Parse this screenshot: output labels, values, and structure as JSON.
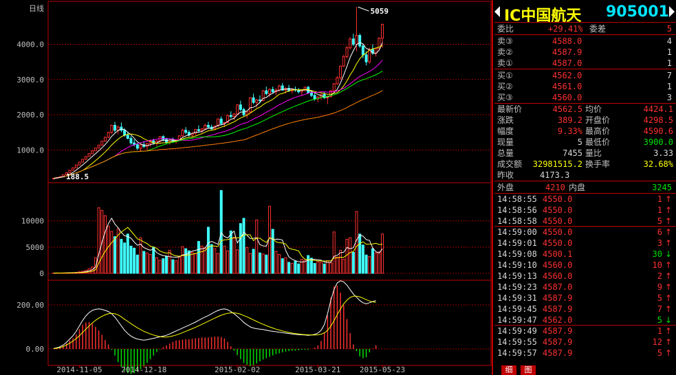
{
  "chart_data": {
    "type": "candlestick",
    "period_label": "日线",
    "price_ticks": [
      "4000.0",
      "3000.0",
      "2000.0",
      "1000.0"
    ],
    "vol_ticks": [
      "10000",
      "5000",
      "0"
    ],
    "macd_ticks": [
      "200.00",
      "0.00"
    ],
    "date_labels": [
      "2014-11-05",
      "2014-12-18",
      "2015-02-02",
      "2015-03-21",
      "2015-05-23"
    ],
    "max_label": "5059",
    "min_label": "188.5",
    "ohlc": [
      [
        190,
        200,
        188.5,
        198
      ],
      [
        200,
        220,
        198,
        218
      ],
      [
        218,
        250,
        215,
        245
      ],
      [
        245,
        300,
        240,
        295
      ],
      [
        295,
        360,
        290,
        355
      ],
      [
        355,
        430,
        350,
        425
      ],
      [
        425,
        500,
        420,
        495
      ],
      [
        495,
        580,
        490,
        575
      ],
      [
        575,
        660,
        570,
        655
      ],
      [
        655,
        740,
        650,
        735
      ],
      [
        735,
        820,
        730,
        815
      ],
      [
        815,
        900,
        810,
        895
      ],
      [
        895,
        980,
        890,
        975
      ],
      [
        975,
        1060,
        970,
        1055
      ],
      [
        1055,
        1150,
        1050,
        1140
      ],
      [
        1140,
        1260,
        1120,
        1250
      ],
      [
        1250,
        1380,
        1230,
        1360
      ],
      [
        1360,
        1520,
        1340,
        1500
      ],
      [
        1500,
        1720,
        1450,
        1700
      ],
      [
        1700,
        1800,
        1500,
        1560
      ],
      [
        1560,
        1700,
        1450,
        1650
      ],
      [
        1650,
        1780,
        1500,
        1560
      ],
      [
        1560,
        1620,
        1380,
        1420
      ],
      [
        1420,
        1500,
        1300,
        1330
      ],
      [
        1330,
        1400,
        1150,
        1200
      ],
      [
        1200,
        1300,
        1100,
        1150
      ],
      [
        1150,
        1200,
        1000,
        1050
      ],
      [
        1050,
        1180,
        950,
        1150
      ],
      [
        1150,
        1250,
        1050,
        1100
      ],
      [
        1100,
        1200,
        1000,
        1180
      ],
      [
        1180,
        1300,
        1100,
        1260
      ],
      [
        1260,
        1320,
        1150,
        1200
      ],
      [
        1200,
        1280,
        1100,
        1250
      ],
      [
        1250,
        1400,
        1200,
        1380
      ],
      [
        1380,
        1420,
        1250,
        1300
      ],
      [
        1300,
        1350,
        1180,
        1220
      ],
      [
        1220,
        1300,
        1150,
        1280
      ],
      [
        1280,
        1350,
        1200,
        1240
      ],
      [
        1240,
        1300,
        1180,
        1290
      ],
      [
        1290,
        1420,
        1250,
        1400
      ],
      [
        1400,
        1600,
        1380,
        1560
      ],
      [
        1560,
        1650,
        1450,
        1500
      ],
      [
        1500,
        1560,
        1380,
        1420
      ],
      [
        1420,
        1500,
        1350,
        1470
      ],
      [
        1470,
        1600,
        1420,
        1580
      ],
      [
        1580,
        1700,
        1500,
        1550
      ],
      [
        1550,
        1620,
        1480,
        1600
      ],
      [
        1600,
        1750,
        1560,
        1700
      ],
      [
        1700,
        1800,
        1600,
        1650
      ],
      [
        1650,
        1720,
        1550,
        1600
      ],
      [
        1600,
        1700,
        1560,
        1680
      ],
      [
        1680,
        1900,
        1650,
        1880
      ],
      [
        1880,
        1950,
        1700,
        1750
      ],
      [
        1750,
        1800,
        1650,
        1780
      ],
      [
        1780,
        2000,
        1750,
        1980
      ],
      [
        1980,
        2100,
        1900,
        1950
      ],
      [
        1950,
        2050,
        1850,
        2020
      ],
      [
        2020,
        2300,
        2000,
        2280
      ],
      [
        2280,
        2400,
        2100,
        2150
      ],
      [
        2150,
        2200,
        1950,
        2000
      ],
      [
        2000,
        2100,
        1900,
        2080
      ],
      [
        2080,
        2500,
        2050,
        2480
      ],
      [
        2480,
        2600,
        2300,
        2350
      ],
      [
        2350,
        2450,
        2200,
        2420
      ],
      [
        2420,
        2550,
        2350,
        2400
      ],
      [
        2400,
        2700,
        2380,
        2680
      ],
      [
        2680,
        2800,
        2550,
        2600
      ],
      [
        2600,
        2750,
        2500,
        2720
      ],
      [
        2720,
        2800,
        2600,
        2650
      ],
      [
        2650,
        2750,
        2550,
        2700
      ],
      [
        2700,
        2850,
        2650,
        2820
      ],
      [
        2820,
        2900,
        2680,
        2700
      ],
      [
        2700,
        2780,
        2600,
        2750
      ],
      [
        2750,
        2850,
        2650,
        2680
      ],
      [
        2680,
        2750,
        2600,
        2720
      ],
      [
        2720,
        2800,
        2650,
        2700
      ],
      [
        2700,
        2760,
        2600,
        2650
      ],
      [
        2650,
        2720,
        2550,
        2700
      ],
      [
        2700,
        2800,
        2650,
        2780
      ],
      [
        2780,
        2820,
        2600,
        2620
      ],
      [
        2620,
        2700,
        2500,
        2550
      ],
      [
        2550,
        2600,
        2400,
        2450
      ],
      [
        2450,
        2550,
        2350,
        2500
      ],
      [
        2500,
        2600,
        2420,
        2580
      ],
      [
        2580,
        2650,
        2450,
        2480
      ],
      [
        2480,
        2550,
        2300,
        2520
      ],
      [
        2520,
        2700,
        2480,
        2680
      ],
      [
        2680,
        2900,
        2650,
        2880
      ],
      [
        2880,
        3100,
        2850,
        3050
      ],
      [
        3050,
        3400,
        3000,
        3380
      ],
      [
        3380,
        3700,
        3350,
        3650
      ],
      [
        3650,
        3950,
        3600,
        3900
      ],
      [
        3900,
        4200,
        3850,
        4150
      ],
      [
        4150,
        4300,
        3950,
        4000
      ],
      [
        4000,
        5059,
        3800,
        4250
      ],
      [
        4250,
        4300,
        3900,
        3950
      ],
      [
        3950,
        4000,
        3600,
        3700
      ],
      [
        3700,
        3800,
        3400,
        3500
      ],
      [
        3500,
        3900,
        3450,
        3850
      ],
      [
        3850,
        4000,
        3700,
        3750
      ],
      [
        3750,
        3900,
        3650,
        3880
      ],
      [
        3880,
        4200,
        3850,
        4173.3
      ],
      [
        4173.3,
        4590.6,
        3900,
        4562.5
      ]
    ],
    "volume": [
      50,
      80,
      60,
      90,
      100,
      120,
      150,
      200,
      300,
      400,
      600,
      900,
      1200,
      3000,
      12500,
      12000,
      11000,
      9000,
      8000,
      7000,
      8500,
      6500,
      5800,
      7500,
      5200,
      4800,
      3500,
      6800,
      4200,
      3900,
      3600,
      5000,
      3000,
      2500,
      2800,
      3200,
      4400,
      2600,
      2400,
      3100,
      5100,
      4700,
      4300,
      4000,
      3800,
      6100,
      5200,
      4900,
      8800,
      5500,
      4700,
      3800,
      15800,
      5200,
      4300,
      8100,
      6900,
      4500,
      9500,
      10500,
      4900,
      3800,
      4600,
      10200,
      3900,
      3700,
      3500,
      12800,
      8400,
      4200,
      3600,
      2800,
      3000,
      2100,
      1900,
      2300,
      1800,
      2700,
      2500,
      3400,
      2900,
      1900,
      2200,
      2100,
      1800,
      2400,
      2000,
      7900,
      3100,
      4400,
      2700,
      6500,
      6800,
      4000,
      11800,
      7500,
      5400,
      3500,
      3200,
      4700,
      3900,
      4100,
      7500
    ],
    "macd_dif": [
      2,
      5,
      10,
      18,
      30,
      45,
      60,
      80,
      105,
      130,
      150,
      165,
      175,
      180,
      182,
      180,
      175,
      170,
      160,
      145,
      125,
      105,
      85,
      70,
      58,
      50,
      45,
      42,
      40,
      42,
      45,
      48,
      52,
      55,
      58,
      62,
      68,
      75,
      82,
      88,
      95,
      102,
      108,
      115,
      122,
      130,
      138,
      145,
      152,
      160,
      168,
      175,
      180,
      182,
      178,
      170,
      160,
      148,
      135,
      120,
      110,
      100,
      95,
      92,
      90,
      88,
      85,
      82,
      80,
      78,
      76,
      74,
      72,
      70,
      68,
      66,
      65,
      64,
      63,
      62,
      63,
      66,
      72,
      85,
      110,
      160,
      220,
      270,
      300,
      310,
      305,
      290,
      270,
      250,
      235,
      220,
      210,
      205,
      210,
      215,
      220
    ],
    "macd_dea": [
      1,
      3,
      6,
      11,
      18,
      26,
      36,
      47,
      60,
      75,
      90,
      104,
      118,
      130,
      140,
      148,
      155,
      160,
      162,
      160,
      155,
      146,
      135,
      125,
      115,
      105,
      96,
      88,
      80,
      74,
      68,
      63,
      59,
      56,
      54,
      54,
      56,
      59,
      63,
      68,
      74,
      80,
      86,
      92,
      98,
      105,
      112,
      119,
      126,
      133,
      140,
      147,
      153,
      158,
      162,
      164,
      164,
      162,
      158,
      152,
      146,
      139,
      132,
      125,
      118,
      112,
      106,
      100,
      95,
      90,
      86,
      82,
      78,
      75,
      72,
      70,
      68,
      66,
      65,
      64,
      63,
      63,
      64,
      67,
      73,
      84,
      103,
      128,
      156,
      182,
      205,
      222,
      234,
      240,
      240,
      237,
      231,
      224,
      218,
      214,
      212
    ],
    "ma_colors": [
      "#ffffff",
      "#ffff00",
      "#ff00ff",
      "#00ff00",
      "#ff8000"
    ]
  },
  "side": {
    "title_code": "IC中国航天",
    "title_num": "905001",
    "order_ratio": {
      "label": "委比",
      "value": "+29.41%",
      "diff_label": "委差",
      "diff": "5"
    },
    "asks": [
      {
        "label": "卖③",
        "price": "4588.0",
        "vol": "4"
      },
      {
        "label": "卖②",
        "price": "4587.9",
        "vol": "1"
      },
      {
        "label": "卖①",
        "price": "4587.0",
        "vol": "1"
      }
    ],
    "bids": [
      {
        "label": "买①",
        "price": "4562.0",
        "vol": "7"
      },
      {
        "label": "买②",
        "price": "4561.0",
        "vol": "1"
      },
      {
        "label": "买③",
        "price": "4560.0",
        "vol": "3"
      }
    ],
    "stats": [
      {
        "l1": "最新价",
        "v1": "4562.5",
        "c1": "red",
        "l2": "均价",
        "v2": "4424.1",
        "c2": "red"
      },
      {
        "l1": "涨跌",
        "v1": "389.2",
        "c1": "red",
        "l2": "开盘价",
        "v2": "4298.5",
        "c2": "red"
      },
      {
        "l1": "幅度",
        "v1": "9.33%",
        "c1": "red",
        "l2": "最高价",
        "v2": "4590.6",
        "c2": "red"
      },
      {
        "l1": "现量",
        "v1": "5",
        "c1": "wht",
        "l2": "最低价",
        "v2": "3900.0",
        "c2": "grn"
      },
      {
        "l1": "总量",
        "v1": "7455",
        "c1": "wht",
        "l2": "量比",
        "v2": "3.33",
        "c2": "wht"
      },
      {
        "l1": "成交额",
        "v1": "32981515.2",
        "c1": "yel",
        "l2": "换手率",
        "v2": "32.68%",
        "c2": "yel"
      }
    ],
    "prev_close": {
      "label": "昨收",
      "value": "4173.3"
    },
    "outer": {
      "label": "外盘",
      "value": "4210",
      "inner_label": "内盘",
      "inner_value": "3245"
    },
    "ticks": [
      {
        "time": "14:58:55",
        "price": "4550.0",
        "vol": "1",
        "dir": "↑"
      },
      {
        "time": "14:58:56",
        "price": "4550.0",
        "vol": "1",
        "dir": "↑"
      },
      {
        "time": "14:58:58",
        "price": "4550.0",
        "vol": "5",
        "dir": "↑"
      },
      {
        "time": "14:59:00",
        "price": "4550.0",
        "vol": "6",
        "dir": "↑"
      },
      {
        "time": "14:59:01",
        "price": "4550.0",
        "vol": "3",
        "dir": "↑"
      },
      {
        "time": "14:59:08",
        "price": "4500.1",
        "vol": "30",
        "dir": "↓"
      },
      {
        "time": "14:59:10",
        "price": "4560.0",
        "vol": "10",
        "dir": "↑"
      },
      {
        "time": "14:59:13",
        "price": "4560.0",
        "vol": "2",
        "dir": "↑"
      },
      {
        "time": "14:59:23",
        "price": "4587.0",
        "vol": "9",
        "dir": "↑"
      },
      {
        "time": "14:59:31",
        "price": "4587.9",
        "vol": "5",
        "dir": "↑"
      },
      {
        "time": "14:59:45",
        "price": "4587.9",
        "vol": "7",
        "dir": "↑"
      },
      {
        "time": "14:59:47",
        "price": "4562.0",
        "vol": "5",
        "dir": "↓"
      },
      {
        "time": "14:59:49",
        "price": "4587.9",
        "vol": "1",
        "dir": "↑"
      },
      {
        "time": "14:59:55",
        "price": "4587.9",
        "vol": "12",
        "dir": "↑"
      },
      {
        "time": "14:59:57",
        "price": "4587.9",
        "vol": "5",
        "dir": "↑"
      }
    ],
    "tabs": [
      "细",
      "图"
    ]
  }
}
